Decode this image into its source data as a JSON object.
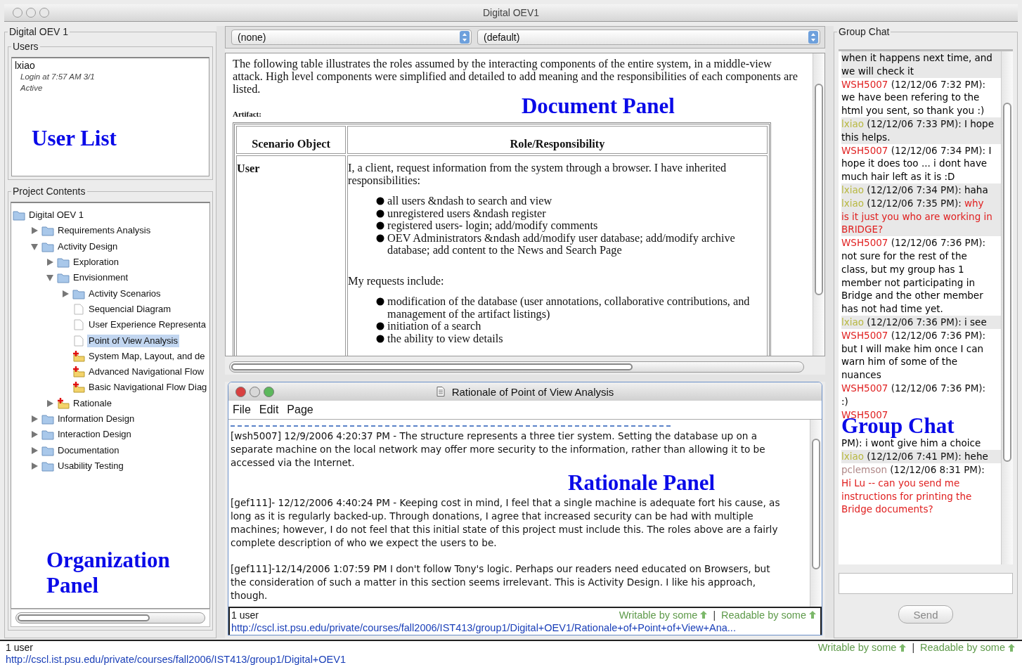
{
  "window": {
    "title": "Digital OEV1"
  },
  "organization": {
    "title": "Digital OEV 1",
    "annotation": "Organization Panel",
    "users": {
      "title": "Users",
      "annotation": "User List",
      "list": [
        {
          "name": "lxiao",
          "login": "Login at 7:57 AM 3/1",
          "status": "Active"
        }
      ]
    },
    "project": {
      "title": "Project Contents",
      "tree": [
        {
          "label": "Digital OEV 1",
          "kind": "folder",
          "selected": false,
          "children": [
            {
              "label": "Requirements Analysis",
              "kind": "folder",
              "expanded": false,
              "selected": false
            },
            {
              "label": "Activity Design",
              "kind": "folder",
              "expanded": true,
              "selected": false,
              "children": [
                {
                  "label": "Exploration",
                  "kind": "folder",
                  "expanded": false,
                  "selected": false
                },
                {
                  "label": "Envisionment",
                  "kind": "folder",
                  "expanded": true,
                  "selected": false,
                  "children": [
                    {
                      "label": "Activity Scenarios",
                      "kind": "folder",
                      "expanded": false,
                      "selected": false
                    },
                    {
                      "label": "Sequencial Diagram",
                      "kind": "page",
                      "selected": false
                    },
                    {
                      "label": "User Experience Representa",
                      "kind": "page",
                      "selected": false
                    },
                    {
                      "label": "Point of View Analysis",
                      "kind": "page",
                      "selected": true
                    },
                    {
                      "label": "System Map, Layout, and de",
                      "kind": "new",
                      "selected": false
                    },
                    {
                      "label": "Advanced Navigational Flow",
                      "kind": "new",
                      "selected": false
                    },
                    {
                      "label": "Basic Navigational Flow Diag",
                      "kind": "new",
                      "selected": false
                    }
                  ]
                },
                {
                  "label": "Rationale",
                  "kind": "new",
                  "expanded": false,
                  "selected": false
                }
              ]
            },
            {
              "label": "Information Design",
              "kind": "folder",
              "expanded": false,
              "selected": false
            },
            {
              "label": "Interaction Design",
              "kind": "folder",
              "expanded": false,
              "selected": false
            },
            {
              "label": "Documentation",
              "kind": "folder",
              "expanded": false,
              "selected": false
            },
            {
              "label": "Usability Testing",
              "kind": "folder",
              "expanded": false,
              "selected": false
            }
          ]
        }
      ]
    }
  },
  "document": {
    "selects": [
      "(none)",
      "(default)"
    ],
    "annotation": "Document Panel",
    "intro": "The following table illustrates the roles assumed by the interacting components of the entire system, in a middle-view attack.  High level components were simplified and detailed to add meaning and the responsibilities of each components are listed.",
    "artifact_label": "Artifact:",
    "table": {
      "columns": [
        "Scenario Object",
        "Role/Responsibility"
      ],
      "rows": [
        {
          "object": "User",
          "blocks": [
            {
              "kind": "paragraph",
              "text": "I, a client, request information from the system through a browser. I have inherited responsibilities:"
            },
            {
              "kind": "list",
              "items": [
                "all users &ndash to search and view",
                "unregistered users &ndash  register",
                "registered users- login; add/modify comments",
                "OEV Administrators &ndash add/modify user database; add/modify archive database; add content to the News and Search Page"
              ]
            },
            {
              "kind": "paragraph",
              "text": "My requests include:"
            },
            {
              "kind": "list",
              "items": [
                "modification of the database (user annotations, collaborative contributions, and management of the artifact listings)",
                "initiation of a search",
                "the ability to view details"
              ]
            }
          ]
        }
      ]
    }
  },
  "rationale": {
    "title": "Rationale of Point of View Analysis",
    "annotation": "Rationale Panel",
    "menu": [
      "File",
      "Edit",
      "Page"
    ],
    "entries": [
      "[wsh5007] 12/9/2006 4:20:37 PM - The structure represents a three tier system.  Setting the database up on a separate machine on the local network may offer more security to the information, rather than allowing it to be accessed via the Internet.",
      "[gef111]- 12/12/2006 4:40:24 PM - Keeping cost in mind, I feel that a single machine is adequate fort his cause, as long as it is regularly backed-up.  Through donations, I agree that increased security can be had with multiple machines; however, I do not feel that this initial state of this project must include this.  The roles above are a fairly complete description of who we expect the users to be.",
      "[gef111]-12/14/2006 1:07:59 PM  I don't follow Tony's logic.  Perhaps our readers need educated on Browsers, but the consideration of such a matter in this section seems irrelevant. This is Activity Design.  I like his approach, though."
    ],
    "status": {
      "users": "1 user",
      "writable": "Writable by some",
      "separator": "|",
      "readable": "Readable by some",
      "url": "http://cscl.ist.psu.edu/private/courses/fall2006/IST413/group1/Digital+OEV1/Rationale+of+Point+of+View+Ana..."
    }
  },
  "chat": {
    "title": "Group Chat",
    "annotation": "Group Chat",
    "send": "Send",
    "messages": [
      {
        "text": "when it happens next time, and we will check it",
        "highlighted": false,
        "shaded": true,
        "annotated": false
      },
      {
        "author": "WSH5007",
        "color": "#e02020",
        "meta": "(12/12/06 7:32 PM): ",
        "text": "we have been refering to the html you sent, so thank you :)",
        "highlighted": false,
        "shaded": false,
        "annotated": false
      },
      {
        "author": "lxiao",
        "color": "#b8b840",
        "meta": "(12/12/06 7:33 PM): ",
        "text": "I hope this helps.",
        "highlighted": false,
        "shaded": true,
        "annotated": false
      },
      {
        "author": "WSH5007",
        "color": "#e02020",
        "meta": "(12/12/06 7:34 PM): ",
        "text": "I hope it does too ... i dont have much hair left as it is :D",
        "highlighted": false,
        "shaded": false,
        "annotated": false
      },
      {
        "author": "lxiao",
        "color": "#b8b840",
        "meta": "(12/12/06 7:34 PM): ",
        "text": "haha",
        "highlighted": false,
        "shaded": true,
        "annotated": false
      },
      {
        "author": "lxiao",
        "color": "#b8b840",
        "meta": "(12/12/06 7:35 PM): ",
        "text": "why is it just you who are working in BRIDGE?",
        "highlighted": true,
        "shaded": true,
        "annotated": false
      },
      {
        "author": "WSH5007",
        "color": "#e02020",
        "meta": "(12/12/06 7:36 PM): ",
        "text": "not sure for the rest of the class, but my group has 1 member not participating in Bridge and the other member has not had time yet.",
        "highlighted": false,
        "shaded": false,
        "annotated": false
      },
      {
        "author": "lxiao",
        "color": "#b8b840",
        "meta": "(12/12/06 7:36 PM): ",
        "text": "i see",
        "highlighted": false,
        "shaded": true,
        "annotated": false
      },
      {
        "author": "WSH5007",
        "color": "#e02020",
        "meta": "(12/12/06 7:36 PM): ",
        "text": "but I will make him once I can warn him of some of the nuances",
        "highlighted": false,
        "shaded": false,
        "annotated": false
      },
      {
        "author": "WSH5007",
        "color": "#e02020",
        "meta": "(12/12/06 7:36 PM): ",
        "text": ":)",
        "highlighted": false,
        "shaded": false,
        "annotated": false
      },
      {
        "author": "WSH5007",
        "color": "#e02020",
        "text": "PM): i wont give him a choice",
        "highlighted": false,
        "shaded": false,
        "annotated": true
      },
      {
        "author": "lxiao",
        "color": "#b8b840",
        "meta": "(12/12/06 7:41 PM): ",
        "text": "hehe",
        "highlighted": false,
        "shaded": true,
        "annotated": false
      },
      {
        "author": "pclemson",
        "color": "#b08888",
        "meta": "(12/12/06 8:31 PM): ",
        "text": "Hi Lu -- can you send me instructions for printing the Bridge documents?",
        "highlighted": true,
        "shaded": false,
        "annotated": false
      }
    ]
  },
  "status_bar": {
    "users": "1 user",
    "writable": "Writable by some",
    "separator": "|",
    "readable": "Readable by some",
    "url": "http://cscl.ist.psu.edu/private/courses/fall2006/IST413/group1/Digital+OEV1"
  }
}
